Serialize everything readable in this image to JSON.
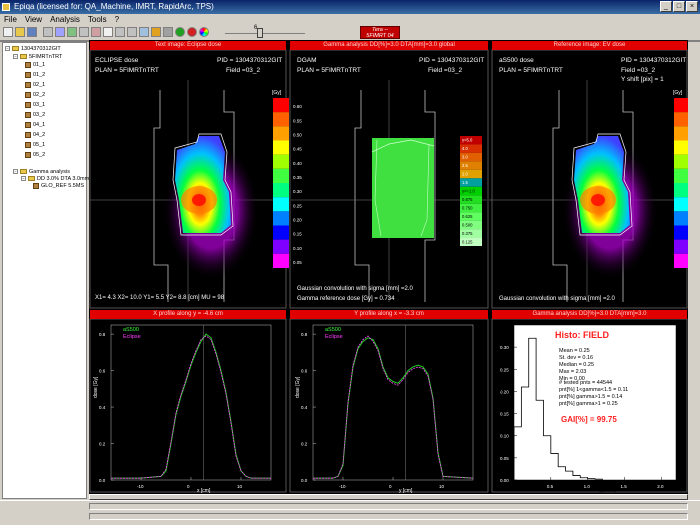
{
  "window": {
    "title": "Epiqa   (licensed for: QA_Machine, IMRT, RapidArc, TPS)"
  },
  "menu": [
    "File",
    "View",
    "Analysis",
    "Tools",
    "?"
  ],
  "toolbar": {
    "slider_value": "6",
    "badge_line1": "Tera --",
    "badge_line2": "5FIMRT 04",
    "colors": {
      "badge": "#c00000",
      "play": "#20a020",
      "stop": "#d02020",
      "wheel": "#e0a020"
    }
  },
  "tree": {
    "root": "1304370312GIT",
    "group": "5FIMRTnTRT",
    "fields": [
      "01_1",
      "01_2",
      "02_1",
      "02_2",
      "03_1",
      "03_2",
      "04_1",
      "04_2",
      "05_1",
      "05_2"
    ],
    "gamma": "Gamma analysis",
    "gamma_item": "DD 3.0% DTA 3.0mm",
    "gamma_ref": "GLO_REF 5.5MS"
  },
  "panels": {
    "test": {
      "title": "Text image: Eclipse dose",
      "line1": "ECLIPSE dose",
      "pid": "PID  = 1304370312GIT",
      "plan": "PLAN = 5FIMRTnTRT",
      "field": "Field =03_2",
      "units": "[Gy]",
      "bottom": "X1=  4.3  X2= 10.0  Y1=  5.5  Y2=  8.8  [cm]     MU =   98",
      "cbar_labels": [
        "0.60",
        "0.55",
        "0.50",
        "0.45",
        "0.40",
        "0.35",
        "0.30",
        "0.25",
        "0.20",
        "0.15",
        "0.10",
        "0.05"
      ]
    },
    "gamma": {
      "title": "Gamma analysis DD[%]=3.0 DTA[mm]=3.0  global",
      "line1": "DGAM",
      "pid": "PID  = 1304370312GIT",
      "plan": "PLAN = 5FIMRTnTRT",
      "field": "Field =03_2",
      "bottom1": "Gaussian convolution with sigma [mm] =2.0",
      "bottom2": "Gamma reference dose [Gy] =   0.734",
      "cbar_labels": [
        "γ>5.0",
        "4.0",
        "3.0",
        "2.5",
        "2.0",
        "1.5",
        "γ<=1.0",
        "0.875",
        "0.750",
        "0.625",
        "0.500",
        "0.375",
        "0.125"
      ]
    },
    "ref": {
      "title": "Reference image: EV dose",
      "line1": "aS500 dose",
      "pid": "PID  = 1304370312GIT",
      "plan": "PLAN = 5FIMRTnTRT",
      "field": "Field =03_2",
      "yshift": "Y shift [pix] =     1",
      "units": "[Gy]",
      "bottom": "Gaussian convolution with sigma [mm] =2.0",
      "cbar_labels": [
        "0.60",
        "0.55",
        "0.50",
        "0.45",
        "0.40",
        "0.35",
        "0.30",
        "0.25",
        "0.20",
        "0.15",
        "0.10",
        "0.05"
      ]
    }
  },
  "profiles": {
    "x": {
      "title": "X profile along y =  -4.6 cm",
      "legend": [
        "aS500",
        "Eclipse"
      ],
      "ylabel": "dose [Gy]",
      "xlabel": "x [cm]",
      "xticks": [
        "-10",
        "0",
        "10"
      ],
      "yticks": [
        "0.8",
        "0.6",
        "0.4",
        "0.2",
        "0.0"
      ]
    },
    "y": {
      "title": "Y profile along x =   -3.3 cm",
      "legend": [
        "aS500",
        "Eclipse"
      ],
      "ylabel": "dose [Gy]",
      "xlabel": "y [cm]",
      "xticks": [
        "-10",
        "0",
        "10"
      ],
      "yticks": [
        "0.8",
        "0.6",
        "0.4",
        "0.2",
        "0.0"
      ]
    }
  },
  "histo": {
    "title": "Gamma analysis DD[%]=3.0 DTA[mm]=3.0",
    "heading": "Histo: FIELD",
    "stats": [
      "Mean =  0.25",
      "St. dev =  0.16",
      "Median =  0.25",
      "Max =  2.03",
      "Min =  0.00"
    ],
    "counts": [
      "# tested pnts = 44544",
      "pnt[%] 1<gamma<1.5 =  0.11",
      "pnt[%] gamma>1.5 =  0.14",
      "pnt[%] gamma>1 =  0.25"
    ],
    "gai": "GAI[%] =  99.75",
    "ylabel": "Fraction of points",
    "xlabel": "gamma",
    "xticks": [
      "0.5",
      "1.0",
      "1.5",
      "2.0"
    ],
    "yticks": [
      "0.30",
      "0.25",
      "0.20",
      "0.15",
      "0.10",
      "0.05",
      "0.00"
    ]
  },
  "chart_data": [
    {
      "type": "line",
      "title": "X profile along y =  -4.6 cm",
      "xlabel": "x [cm]",
      "ylabel": "dose [Gy]",
      "xlim": [
        -16,
        16
      ],
      "ylim": [
        0,
        0.85
      ],
      "series": [
        {
          "name": "aS500",
          "color": "#20d020",
          "x": [
            -16,
            -10,
            -6,
            -5,
            -4,
            -3,
            -2,
            -1,
            0,
            1,
            2,
            3,
            4,
            5,
            6,
            7,
            8,
            9,
            10,
            11,
            12,
            16
          ],
          "y": [
            0.01,
            0.01,
            0.02,
            0.05,
            0.2,
            0.36,
            0.46,
            0.54,
            0.63,
            0.7,
            0.76,
            0.8,
            0.78,
            0.7,
            0.6,
            0.48,
            0.32,
            0.14,
            0.05,
            0.02,
            0.01,
            0.01
          ]
        },
        {
          "name": "Eclipse",
          "color": "#ff40ff",
          "x": [
            -16,
            -10,
            -6,
            -5,
            -4,
            -3,
            -2,
            -1,
            0,
            1,
            2,
            3,
            4,
            5,
            6,
            7,
            8,
            9,
            10,
            11,
            12,
            16
          ],
          "y": [
            0.01,
            0.01,
            0.02,
            0.06,
            0.21,
            0.37,
            0.47,
            0.55,
            0.64,
            0.71,
            0.77,
            0.79,
            0.77,
            0.69,
            0.59,
            0.47,
            0.31,
            0.13,
            0.05,
            0.02,
            0.01,
            0.01
          ]
        }
      ]
    },
    {
      "type": "line",
      "title": "Y profile along x =   -3.3 cm",
      "xlabel": "y [cm]",
      "ylabel": "dose [Gy]",
      "xlim": [
        -16,
        16
      ],
      "ylim": [
        0,
        0.85
      ],
      "series": [
        {
          "name": "aS500",
          "color": "#20d020",
          "x": [
            -16,
            -12,
            -11,
            -10,
            -9,
            -8,
            -7,
            -6,
            -5,
            -4,
            -3,
            -2,
            -1,
            0,
            1,
            2,
            3,
            4,
            5,
            6,
            7,
            8,
            9,
            10,
            16
          ],
          "y": [
            0.01,
            0.01,
            0.02,
            0.08,
            0.42,
            0.62,
            0.72,
            0.76,
            0.78,
            0.77,
            0.72,
            0.62,
            0.56,
            0.54,
            0.53,
            0.56,
            0.6,
            0.62,
            0.63,
            0.62,
            0.58,
            0.45,
            0.15,
            0.02,
            0.01
          ]
        },
        {
          "name": "Eclipse",
          "color": "#ff40ff",
          "x": [
            -16,
            -12,
            -11,
            -10,
            -9,
            -8,
            -7,
            -6,
            -5,
            -4,
            -3,
            -2,
            -1,
            0,
            1,
            2,
            3,
            4,
            5,
            6,
            7,
            8,
            9,
            10,
            16
          ],
          "y": [
            0.01,
            0.01,
            0.02,
            0.09,
            0.43,
            0.63,
            0.73,
            0.77,
            0.79,
            0.76,
            0.71,
            0.61,
            0.55,
            0.53,
            0.52,
            0.55,
            0.59,
            0.61,
            0.62,
            0.61,
            0.57,
            0.44,
            0.14,
            0.02,
            0.01
          ]
        }
      ]
    },
    {
      "type": "bar",
      "title": "Histo: FIELD",
      "xlabel": "gamma",
      "ylabel": "Fraction of points",
      "xlim": [
        0,
        2.2
      ],
      "ylim": [
        0,
        0.35
      ],
      "bins": [
        0,
        0.1,
        0.2,
        0.3,
        0.4,
        0.5,
        0.6,
        0.7,
        0.8,
        0.9,
        1.0,
        1.1,
        1.2
      ],
      "values": [
        0.12,
        0.21,
        0.32,
        0.18,
        0.1,
        0.06,
        0.03,
        0.02,
        0.01,
        0.005,
        0.003,
        0.002
      ]
    }
  ]
}
